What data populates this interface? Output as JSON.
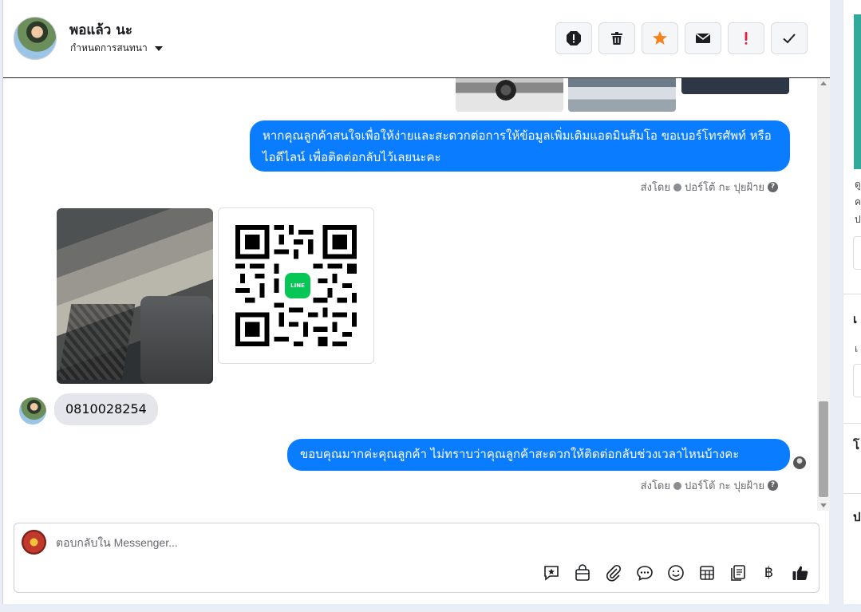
{
  "header": {
    "contact_name": "พอแล้ว นะ",
    "assign_label": "กำหนดการสนทนา",
    "actions": [
      "block-icon",
      "trash-icon",
      "star-icon",
      "envelope-icon",
      "exclamation-icon",
      "check-icon"
    ]
  },
  "colors": {
    "outgoing_bubble": "#0a7cff",
    "incoming_bubble": "#e4e6eb",
    "star": "#f5841f",
    "exclamation": "#e41e3f"
  },
  "messages": {
    "m1_text": "หากคุณลูกค้าสนใจเพื่อให้ง่ายและสะดวกต่อการให้ข้อมูลเพิ่มเติมแอดมินส้มโอ ขอเบอร์โทรศัพท์ หรือ ไอดีไลน์ เพื่อติดต่อกลับไว้เลยนะคะ",
    "m1_sent_by_prefix": "ส่งโดย",
    "m1_sent_by_name": "ปอร์โต้ กะ ปุยฝ้าย",
    "qr_logo_text": "LINE",
    "incoming_text": "0810028254",
    "m2_text": "ขอบคุณมากค่ะคุณลูกค้า ไม่ทราบว่าคุณลูกค้าสะดวกให้ติดต่อกลับช่วงเวลาไหนบ้างคะ",
    "m2_sent_by_prefix": "ส่งโดย",
    "m2_sent_by_name": "ปอร์โต้ กะ ปุยฝ้าย"
  },
  "composer": {
    "placeholder": "ตอบกลับใน Messenger...",
    "tools": [
      "saved-reply-icon",
      "shop-bag-icon",
      "attachment-icon",
      "chat-bubble-icon",
      "emoji-icon",
      "table-icon",
      "document-icon",
      "baht-icon",
      "thumbs-up-icon"
    ],
    "baht_symbol": "฿"
  },
  "right_panel": {
    "chars": [
      "ดู",
      "ค",
      "ป",
      "เ",
      "เ",
      "โ",
      "ป"
    ]
  }
}
